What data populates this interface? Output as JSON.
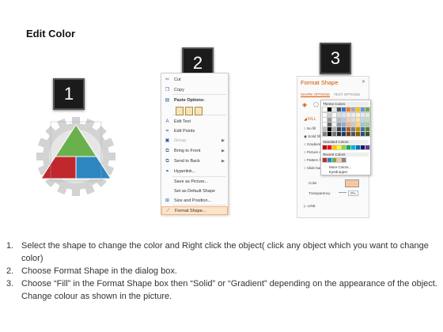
{
  "page": {
    "title": "Edit Color"
  },
  "steps_badges": [
    "1",
    "2",
    "3"
  ],
  "context_menu": {
    "items": [
      {
        "label": "Cut",
        "icon": "scissors-icon",
        "glyph": "✂"
      },
      {
        "label": "Copy",
        "icon": "copy-icon",
        "glyph": "❐"
      },
      {
        "label": "Paste Options:",
        "icon": "paste-icon",
        "glyph": "▤",
        "bold": true
      },
      {
        "label": "Edit Text",
        "icon": "edit-text-icon",
        "glyph": "A"
      },
      {
        "label": "Edit Points",
        "icon": "edit-points-icon",
        "glyph": "⌗"
      },
      {
        "label": "Group",
        "icon": "group-icon",
        "glyph": "▣",
        "disabled": true,
        "submenu": true
      },
      {
        "label": "Bring to Front",
        "icon": "bring-to-front-icon",
        "glyph": "⧉",
        "submenu": true
      },
      {
        "label": "Send to Back",
        "icon": "send-to-back-icon",
        "glyph": "⧉",
        "submenu": true
      },
      {
        "label": "Hyperlink...",
        "icon": "hyperlink-icon",
        "glyph": "⚭"
      },
      {
        "label": "Save as Picture...",
        "icon": "",
        "glyph": ""
      },
      {
        "label": "Set as Default Shape",
        "icon": "",
        "glyph": ""
      },
      {
        "label": "Size and Position...",
        "icon": "size-position-icon",
        "glyph": "⊞"
      },
      {
        "label": "Format Shape...",
        "icon": "format-shape-icon",
        "glyph": "⟋",
        "highlighted": true
      }
    ]
  },
  "format_pane": {
    "title": "Format Shape",
    "tab_shape": "SHAPE OPTIONS",
    "tab_text": "TEXT OPTIONS",
    "fill_label": "FILL",
    "fill_options": [
      "No fill",
      "Solid fill",
      "Gradient fill",
      "Picture or texture fill",
      "Pattern fill",
      "Slide background fill"
    ],
    "color_label": "Color",
    "transparency_label": "Transparency",
    "transparency_value": "0%",
    "line_label": "LINE",
    "palette": {
      "theme_label": "Theme Colors",
      "standard_label": "Standard Colors",
      "recent_label": "Recent Colors",
      "more_colors": "More Colors...",
      "eyedropper": "Eyedropper"
    }
  },
  "instructions": [
    {
      "num": "1.",
      "text": "Select the shape to change the color and Right click the object( click any object which you want to change color)"
    },
    {
      "num": "2.",
      "text": "Choose Format Shape in the dialog box."
    },
    {
      "num": "3.",
      "text": "Choose “Fill” in the Format Shape box then “Solid” or “Gradient” depending on the appearance of the object. Change colour as shown in the picture."
    }
  ],
  "colors": {
    "gear": "#d3d3d3",
    "triangle_top": "#6ab04c",
    "triangle_left": "#c0282d",
    "triangle_right": "#2e86c1",
    "accent": "#d35400"
  }
}
